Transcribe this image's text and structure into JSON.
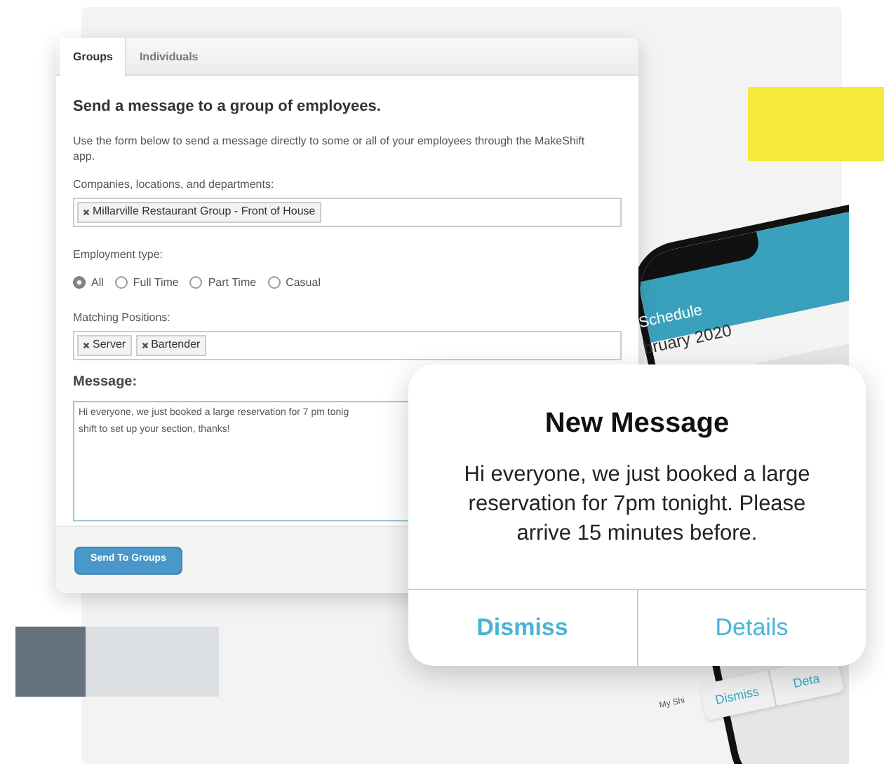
{
  "tabs": [
    {
      "label": "Groups",
      "selected": true
    },
    {
      "label": "Individuals",
      "selected": false
    }
  ],
  "form": {
    "heading": "Send a message to a group of employees.",
    "description": "Use the form below to send a message directly to some or all of your employees through the MakeShift app.",
    "companies_label": "Companies, locations, and departments:",
    "companies_tags": [
      "Millarville Restaurant Group - Front of House"
    ],
    "employment_label": "Employment type:",
    "employment_options": [
      {
        "label": "All",
        "selected": true
      },
      {
        "label": "Full Time",
        "selected": false
      },
      {
        "label": "Part Time",
        "selected": false
      },
      {
        "label": "Casual",
        "selected": false
      }
    ],
    "positions_label": "Matching Positions:",
    "position_tags": [
      "Server",
      "Bartender"
    ],
    "message_label": "Message:",
    "message_lines": [
      "Hi everyone, we just booked a large reservation for 7 pm tonig",
      "shift to set up your section, thanks!"
    ],
    "submit": "Send To Groups"
  },
  "phone": {
    "header": "Schedule",
    "month": "bruary 2020",
    "tab_label": "My Shi",
    "buttons": [
      "Dismiss",
      "Deta"
    ]
  },
  "notification": {
    "title": "New Message",
    "body": "Hi everyone, we just booked a large reservation for 7pm tonight. Please arrive 15 minutes before.",
    "buttons": [
      {
        "label": "Dismiss",
        "bold": true
      },
      {
        "label": "Details",
        "bold": false
      }
    ]
  }
}
